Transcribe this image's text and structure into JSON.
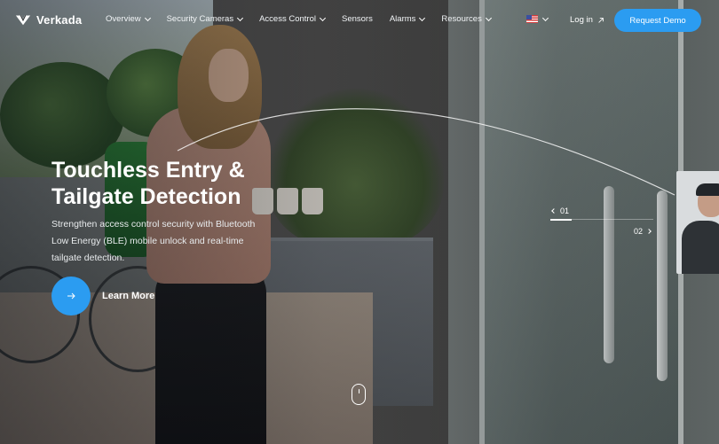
{
  "brand": {
    "name": "Verkada",
    "logo_icon": "verkada-checkmark-logo",
    "accent_color": "#2b9cf1"
  },
  "nav": {
    "items": [
      {
        "label": "Overview",
        "has_dropdown": true
      },
      {
        "label": "Security Cameras",
        "has_dropdown": true
      },
      {
        "label": "Access Control",
        "has_dropdown": true
      },
      {
        "label": "Sensors",
        "has_dropdown": false
      },
      {
        "label": "Alarms",
        "has_dropdown": true
      },
      {
        "label": "Resources",
        "has_dropdown": true
      }
    ],
    "locale_icon": "us-flag-icon",
    "login_label": "Log in",
    "cta_label": "Request Demo"
  },
  "hero": {
    "title_line1": "Touchless Entry &",
    "title_line2": "Tailgate Detection",
    "description": "Strengthen access control security with Bluetooth Low Energy (BLE) mobile unlock and real-time tailgate detection.",
    "learn_more_label": "Learn More",
    "learn_more_icon": "arrow-right-icon"
  },
  "slider": {
    "current": "01",
    "next": "02"
  },
  "scroll_indicator_icon": "mouse-scroll-icon"
}
